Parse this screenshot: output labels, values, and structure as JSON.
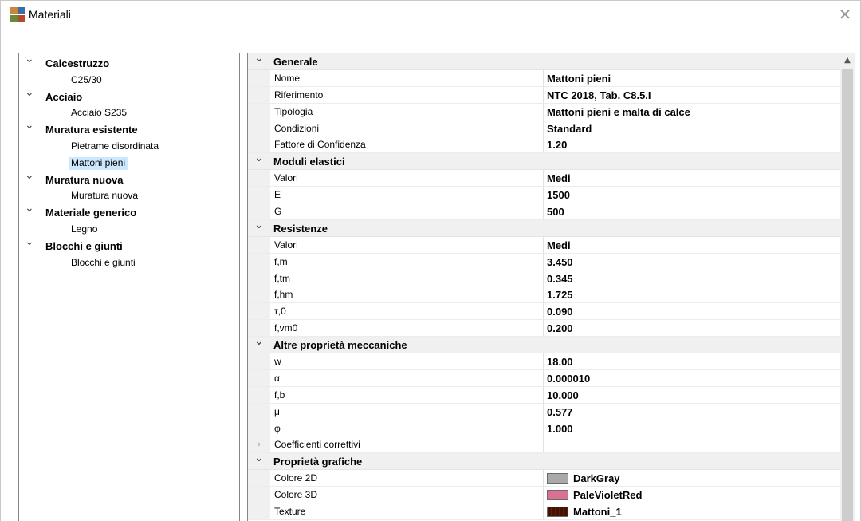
{
  "window": {
    "title": "Materiali",
    "close_glyph": "✕"
  },
  "tree": {
    "groups": [
      {
        "label": "Calcestruzzo",
        "expanded": true,
        "children": [
          {
            "label": "C25/30",
            "selected": false
          }
        ]
      },
      {
        "label": "Acciaio",
        "expanded": true,
        "children": [
          {
            "label": "Acciaio S235",
            "selected": false
          }
        ]
      },
      {
        "label": "Muratura esistente",
        "expanded": true,
        "children": [
          {
            "label": "Pietrame disordinata",
            "selected": false
          },
          {
            "label": "Mattoni pieni",
            "selected": true
          }
        ]
      },
      {
        "label": "Muratura nuova",
        "expanded": true,
        "children": [
          {
            "label": "Muratura nuova",
            "selected": false
          }
        ]
      },
      {
        "label": "Materiale generico",
        "expanded": true,
        "children": [
          {
            "label": "Legno",
            "selected": false
          }
        ]
      },
      {
        "label": "Blocchi e giunti",
        "expanded": true,
        "children": [
          {
            "label": "Blocchi e giunti",
            "selected": false
          }
        ]
      }
    ]
  },
  "properties": {
    "categories": [
      {
        "label": "Generale",
        "rows": [
          {
            "name": "Nome",
            "value": "Mattoni pieni"
          },
          {
            "name": "Riferimento",
            "value": "NTC 2018, Tab. C8.5.I"
          },
          {
            "name": "Tipologia",
            "value": "Mattoni pieni e malta di calce"
          },
          {
            "name": "Condizioni",
            "value": "Standard"
          },
          {
            "name": "Fattore di Confidenza",
            "value": "1.20"
          }
        ]
      },
      {
        "label": "Moduli elastici",
        "rows": [
          {
            "name": "Valori",
            "value": "Medi"
          },
          {
            "name": "E",
            "value": "1500"
          },
          {
            "name": "G",
            "value": "500"
          }
        ]
      },
      {
        "label": "Resistenze",
        "rows": [
          {
            "name": "Valori",
            "value": "Medi"
          },
          {
            "name": "f,m",
            "value": "3.450"
          },
          {
            "name": "f,tm",
            "value": "0.345"
          },
          {
            "name": "f,hm",
            "value": "1.725"
          },
          {
            "name": "τ,0",
            "value": "0.090"
          },
          {
            "name": "f,vm0",
            "value": "0.200"
          }
        ]
      },
      {
        "label": "Altre proprietà meccaniche",
        "rows": [
          {
            "name": "w",
            "value": "18.00"
          },
          {
            "name": "α",
            "value": "0.000010"
          },
          {
            "name": "f,b",
            "value": "10.000"
          },
          {
            "name": "μ",
            "value": "0.577"
          },
          {
            "name": "φ",
            "value": "1.000"
          },
          {
            "name": "Coefficienti correttivi",
            "value": "",
            "collapsed_sub": true
          }
        ]
      },
      {
        "label": "Proprietà grafiche",
        "rows": [
          {
            "name": "Colore 2D",
            "value": "DarkGray",
            "swatch": "#a9a9a9"
          },
          {
            "name": "Colore 3D",
            "value": "PaleVioletRed",
            "swatch": "#db7093"
          },
          {
            "name": "Texture",
            "value": "Mattoni_1",
            "swatch": "texture"
          }
        ]
      }
    ]
  }
}
